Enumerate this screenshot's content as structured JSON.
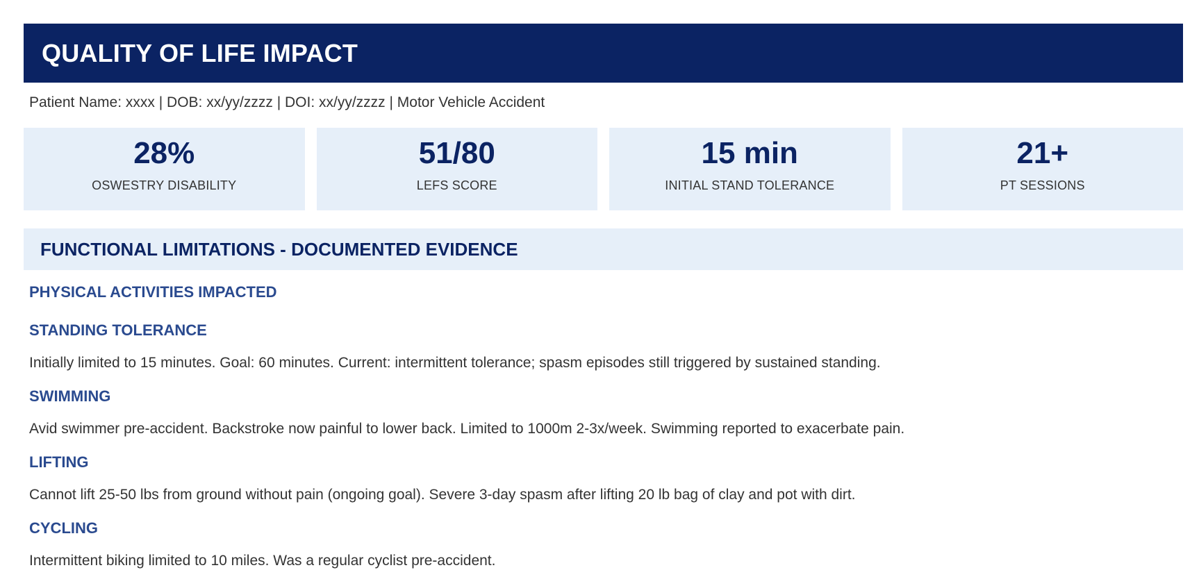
{
  "header": {
    "title": "QUALITY OF LIFE IMPACT"
  },
  "patient_line": "Patient Name: xxxx | DOB: xx/yy/zzzz | DOI: xx/yy/zzzz | Motor Vehicle Accident",
  "stats": [
    {
      "value": "28%",
      "label": "OSWESTRY DISABILITY"
    },
    {
      "value": "51/80",
      "label": "LEFS SCORE"
    },
    {
      "value": "15 min",
      "label": "INITIAL STAND TOLERANCE"
    },
    {
      "value": "21+",
      "label": "PT SESSIONS"
    }
  ],
  "section": {
    "title": "FUNCTIONAL LIMITATIONS - DOCUMENTED EVIDENCE",
    "subheading": "PHYSICAL ACTIVITIES IMPACTED",
    "items": [
      {
        "title": "STANDING TOLERANCE",
        "text": "Initially limited to 15 minutes. Goal: 60 minutes. Current: intermittent tolerance; spasm episodes still triggered by sustained standing."
      },
      {
        "title": "SWIMMING",
        "text": "Avid swimmer pre-accident. Backstroke now painful to lower back. Limited to 1000m 2-3x/week. Swimming reported to exacerbate pain."
      },
      {
        "title": "LIFTING",
        "text": "Cannot lift 25-50 lbs from ground without pain (ongoing goal). Severe 3-day spasm after lifting 20 lb bag of clay and pot with dirt."
      },
      {
        "title": "CYCLING",
        "text": "Intermittent biking limited to 10 miles. Was a regular cyclist pre-accident."
      }
    ]
  },
  "colors": {
    "header_bg": "#0b2363",
    "card_bg": "#e6eff9",
    "heading_blue": "#2a4a8f",
    "body_text": "#333333"
  }
}
